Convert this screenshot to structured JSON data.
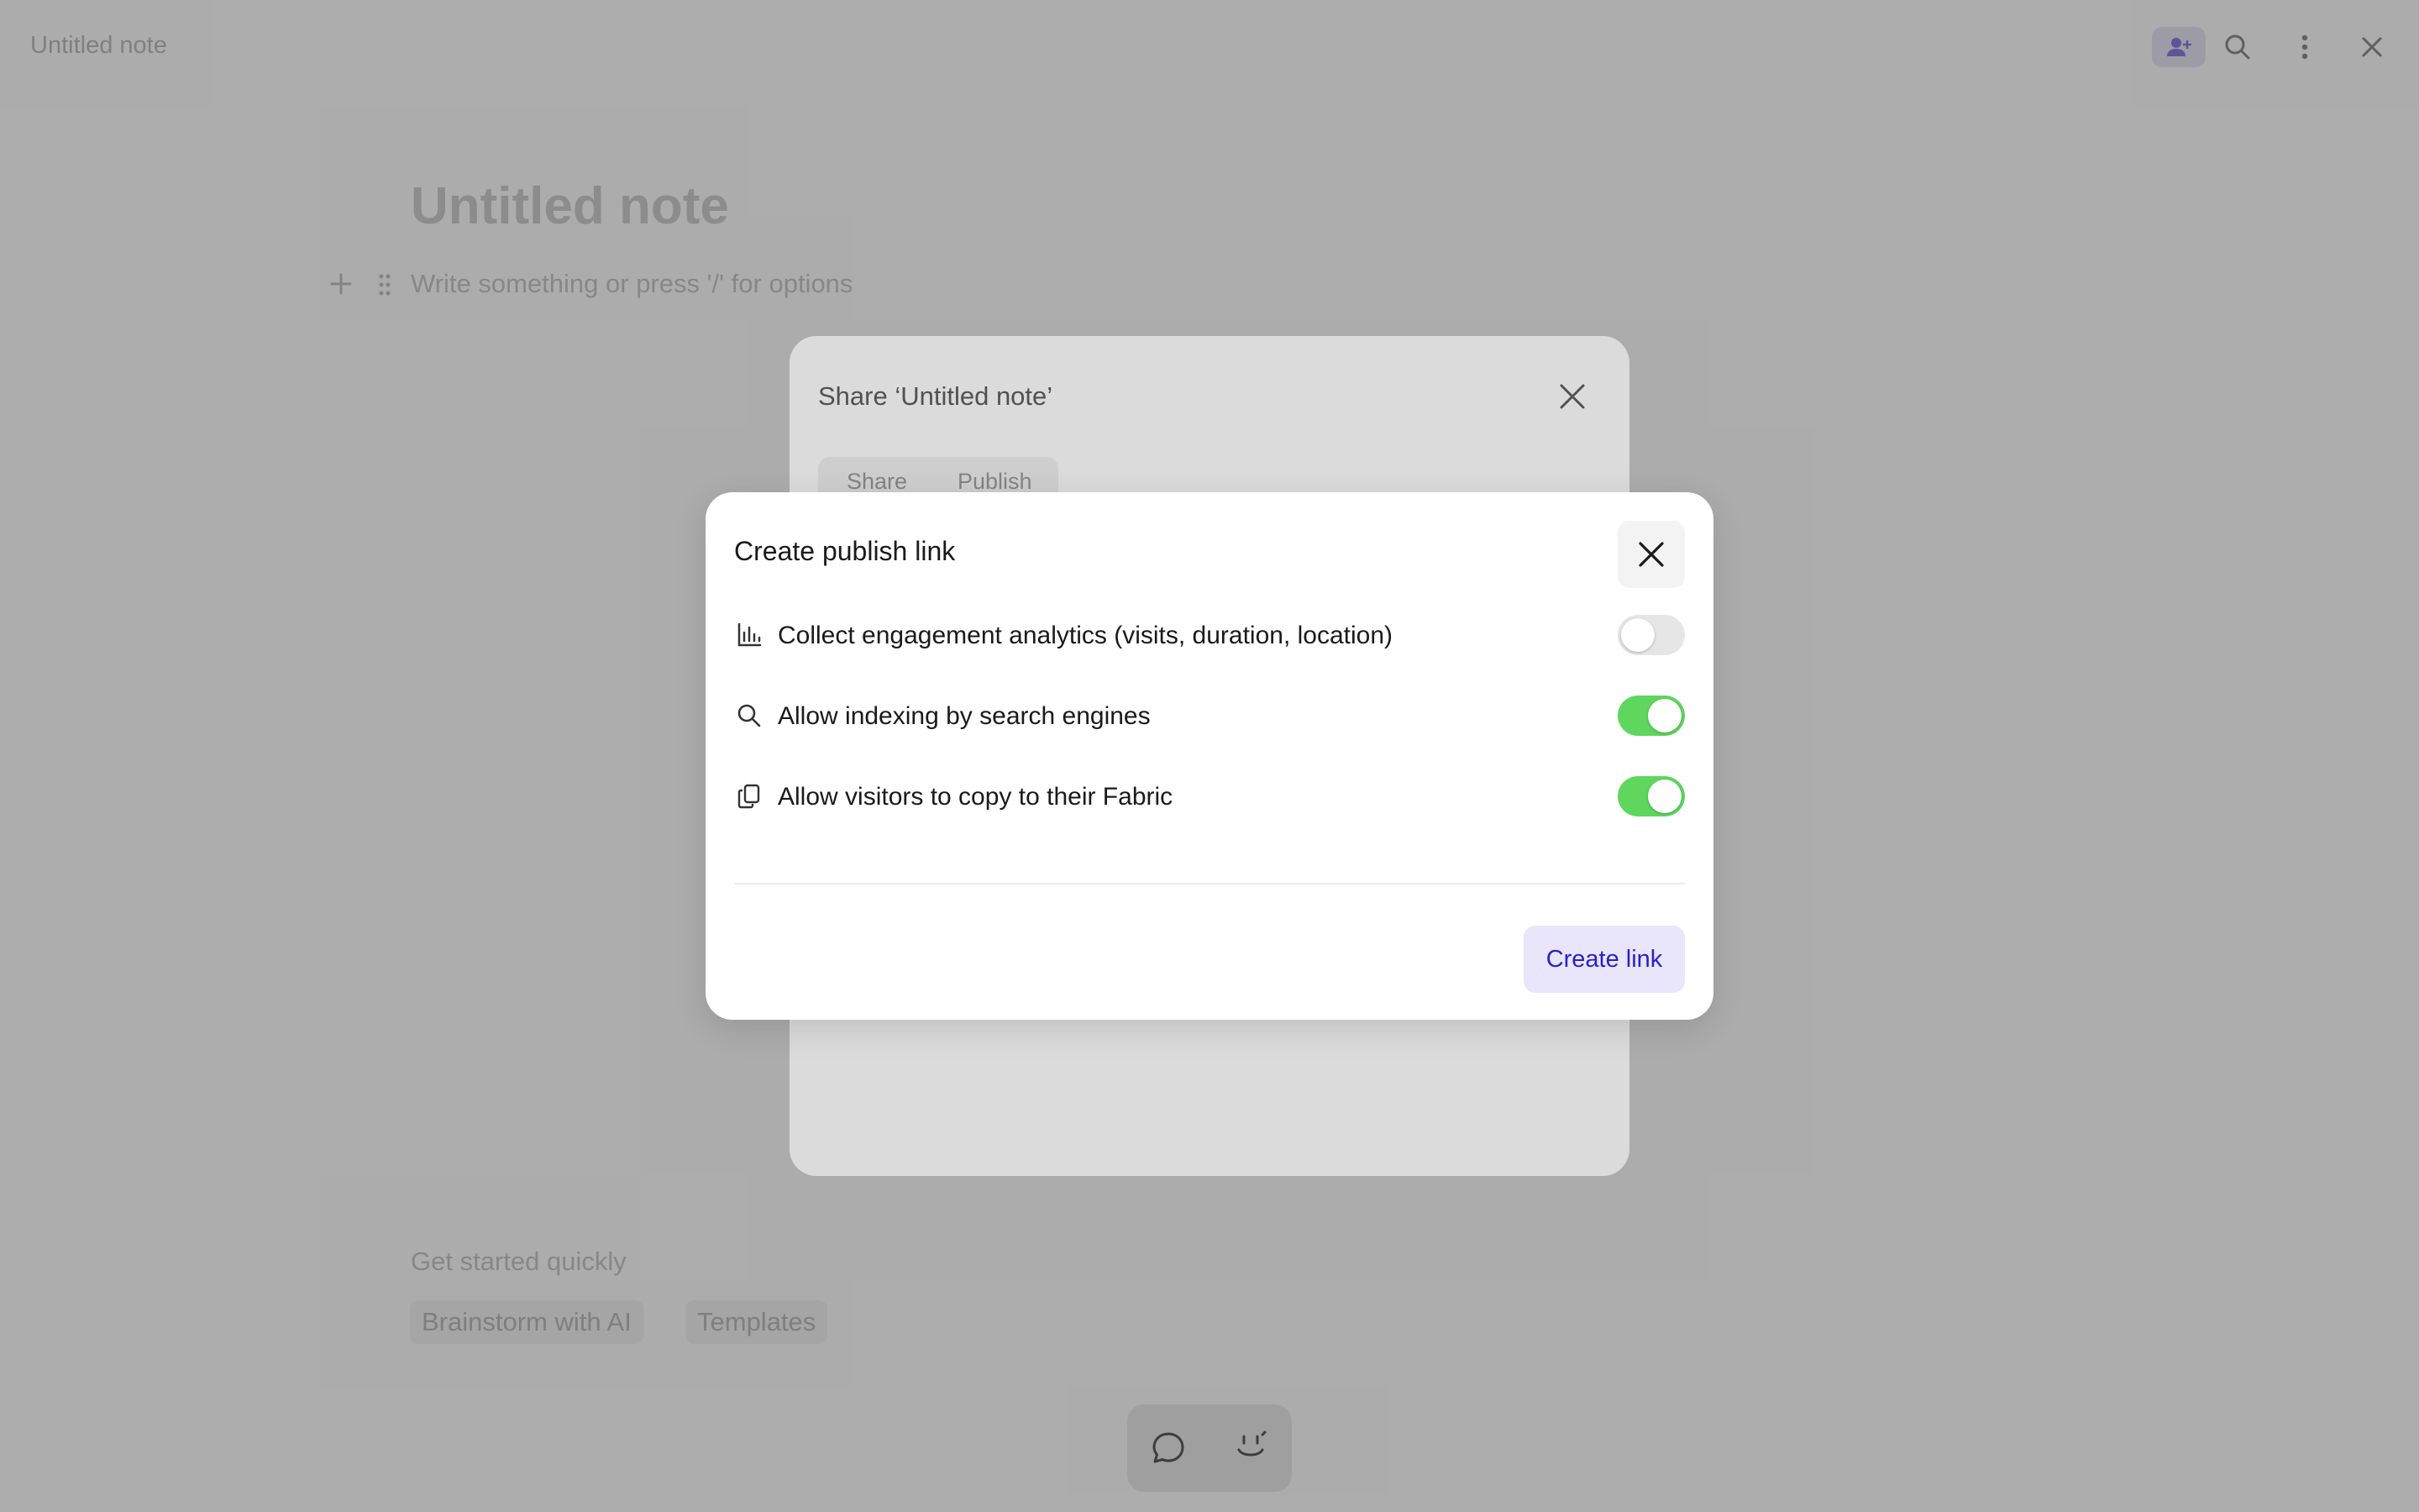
{
  "window": {
    "title": "Untitled note"
  },
  "note": {
    "title": "Untitled note",
    "placeholder": "Write something or press '/' for options"
  },
  "quick_start": {
    "title": "Get started quickly",
    "chips": [
      "Brainstorm with AI",
      "Templates"
    ]
  },
  "share_dialog": {
    "title": "Share ‘Untitled note’",
    "tabs": [
      "Share",
      "Publish"
    ]
  },
  "modal": {
    "title": "Create publish link",
    "options": [
      {
        "label": "Collect engagement analytics (visits, duration, location)",
        "icon": "bar-chart-icon",
        "enabled": false
      },
      {
        "label": "Allow indexing by search engines",
        "icon": "search-icon",
        "enabled": true
      },
      {
        "label": "Allow visitors to copy to their Fabric",
        "icon": "copy-icon",
        "enabled": true
      }
    ],
    "create_label": "Create link"
  },
  "colors": {
    "toggle_on": "#5fd65e",
    "toggle_off": "#e6e6e6",
    "primary_button_bg": "#e9e6fb",
    "primary_button_text": "#2a1fc7"
  }
}
